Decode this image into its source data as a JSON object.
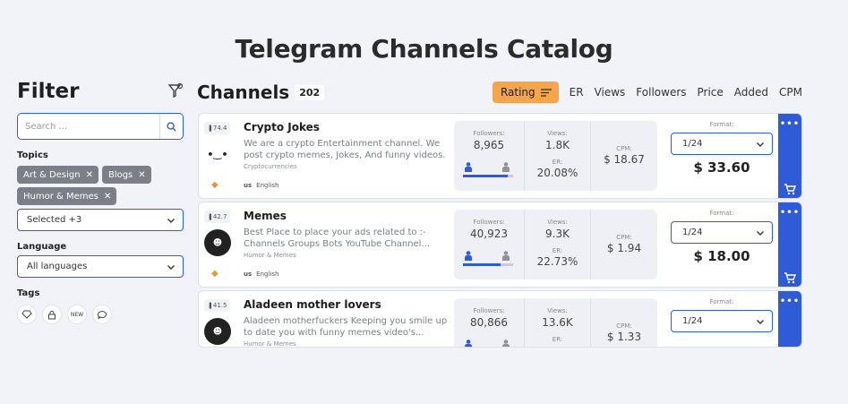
{
  "page_title": "Telegram Channels Catalog",
  "filter": {
    "title": "Filter",
    "search_placeholder": "Search ...",
    "topics_label": "Topics",
    "topic_chips": [
      "Art & Design",
      "Blogs",
      "Humor & Memes"
    ],
    "topics_select": "Selected +3",
    "language_label": "Language",
    "language_select": "All languages",
    "tags_label": "Tags",
    "tags": [
      "diamond-icon",
      "lock-icon",
      "NEW",
      "chat-icon"
    ],
    "new_tag_text": "NEW"
  },
  "channels": {
    "title": "Channels",
    "count": "202",
    "sort_active": "Rating",
    "sort_options": [
      "ER",
      "Views",
      "Followers",
      "Price",
      "Added",
      "CPM"
    ]
  },
  "labels": {
    "followers": "Followers:",
    "views": "Views:",
    "er": "ER:",
    "cpm": "CPM:",
    "format": "Format:",
    "more": "•••"
  },
  "cards": [
    {
      "rank": "74.4",
      "name": "Crypto Jokes",
      "desc": "We are a crypto Entertainment channel. We post crypto memes, Jokes, And funny videos.",
      "category": "Cryptocurrencies",
      "country": "us",
      "language": "English",
      "followers": "8,965",
      "views": "1.8K",
      "er": "20.08%",
      "cpm": "$ 18.67",
      "format": "1/24",
      "price": "$ 33.60",
      "gender_male_share": 0.9
    },
    {
      "rank": "42.7",
      "name": "Memes",
      "desc": "Best Place to place your ads related to :- Channels Groups Bots YouTube Channel...",
      "category": "Humor & Memes",
      "country": "us",
      "language": "English",
      "followers": "40,923",
      "views": "9.3K",
      "er": "22.73%",
      "cpm": "$ 1.94",
      "format": "1/24",
      "price": "$ 18.00",
      "gender_male_share": 0.75
    },
    {
      "rank": "41.5",
      "name": "Aladeen mother lovers",
      "desc": "Aladeen motherfuckers Keeping you smile up to date you with funny memes video's...",
      "category": "Humor & Memes",
      "country": "",
      "language": "",
      "followers": "80,866",
      "views": "13.6K",
      "er": "",
      "cpm": "$ 1.33",
      "format": "1/24",
      "price": "",
      "gender_male_share": 0.8
    }
  ]
}
